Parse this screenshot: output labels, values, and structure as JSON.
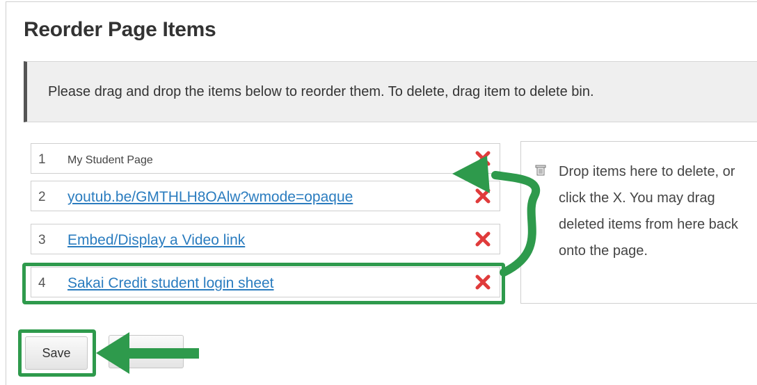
{
  "page": {
    "title": "Reorder Page Items",
    "instructions": "Please drag and drop the items below to reorder them. To delete, drag item to delete bin."
  },
  "items": [
    {
      "number": "1",
      "label": "My Student Page",
      "is_link": false
    },
    {
      "number": "2",
      "label": "youtub.be/GMTHLH8OAlw?wmode=opaque",
      "is_link": true
    },
    {
      "number": "3",
      "label": "Embed/Display a Video link",
      "is_link": true
    },
    {
      "number": "4",
      "label": "Sakai Credit student login sheet",
      "is_link": true
    }
  ],
  "delete_bin": {
    "text": "Drop items here to delete, or click the X. You may drag deleted items from here back onto the page.",
    "icon": "trash-icon"
  },
  "buttons": {
    "save_label": "Save",
    "cancel_label": ""
  },
  "annotation": {
    "highlight_color": "#2e9a4c",
    "delete_icon": "close-x-icon",
    "delete_color": "#e03b3b",
    "link_color": "#2a7cbf"
  }
}
